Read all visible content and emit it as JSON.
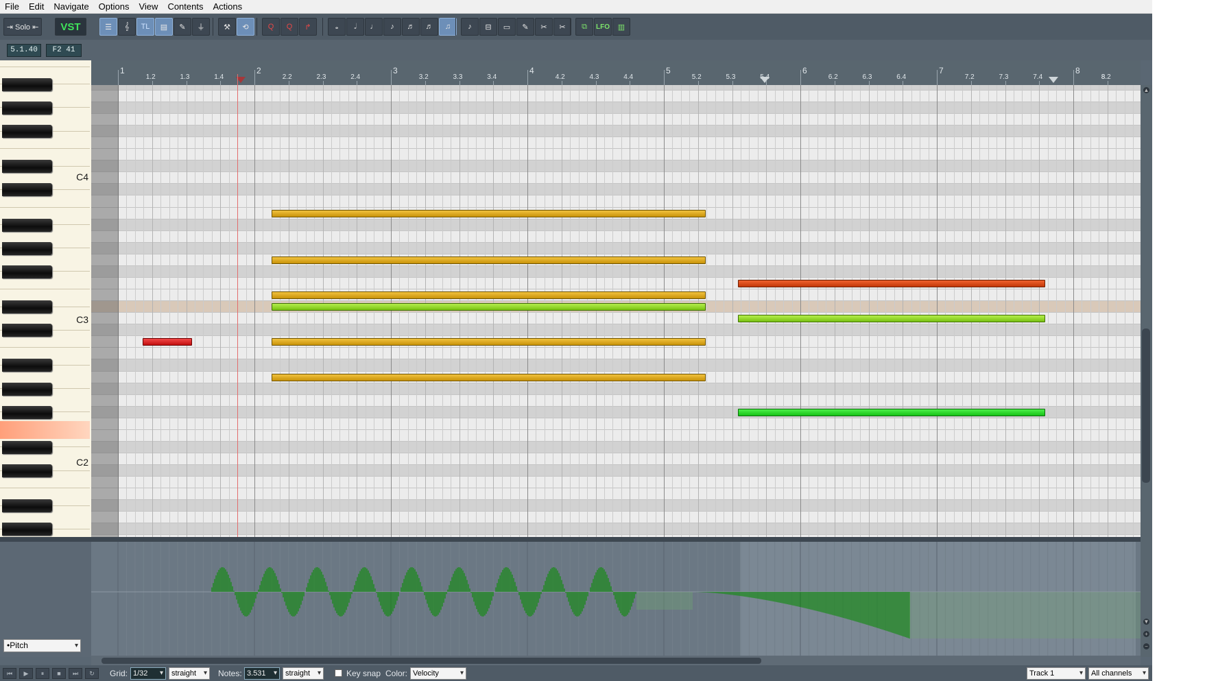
{
  "menu": [
    "File",
    "Edit",
    "Navigate",
    "Options",
    "View",
    "Contents",
    "Actions"
  ],
  "toolbar": {
    "solo_label": "⇥ Solo ⇤",
    "vst_label": "VST",
    "tl_label": "TL",
    "lfo_label": "LFO",
    "buttons": [
      "piano-roll-view-icon",
      "notation-view-icon",
      "timeline-toggle",
      "event-list-icon",
      "step-input-icon",
      "insert-icon",
      "humanize-icon",
      "loop-icon",
      "quantize-icon",
      "quantize-settings-icon",
      "redo-icon",
      "whole-note-icon",
      "half-note-icon",
      "quarter-note-icon",
      "eighth-note-icon",
      "sixteenth-note-icon",
      "thirtysecond-note-icon",
      "grid-note-icon",
      "legato-icon",
      "glue-icon",
      "velocity-icon",
      "draw-tool-icon",
      "erase-icon",
      "split-icon",
      "lane-view-icon",
      "lfo-icon",
      "mixer-icon"
    ]
  },
  "status": {
    "position": "5.1.40",
    "note": "F2 41"
  },
  "ruler": {
    "bars": [
      "1",
      "2",
      "3",
      "4",
      "5",
      "6",
      "7",
      "8"
    ],
    "beats": [
      "1.2",
      "1.3",
      "1.4",
      "2.2",
      "2.3",
      "2.4",
      "3.2",
      "3.3",
      "3.4",
      "4.2",
      "4.3",
      "4.4",
      "5.2",
      "5.3",
      "5.4",
      "6.2",
      "6.3",
      "6.4",
      "7.2",
      "7.3",
      "7.4",
      "8.2",
      "8."
    ]
  },
  "keyboard": {
    "labels": [
      "C4",
      "C3",
      "C2"
    ]
  },
  "notes": [
    {
      "name": "note",
      "pitch": "B3",
      "start": "2.1",
      "end": "5.2",
      "color": "gold",
      "hex": "#d9a51c"
    },
    {
      "name": "note",
      "pitch": "G3",
      "start": "2.1",
      "end": "5.2",
      "color": "gold",
      "hex": "#d9a51c"
    },
    {
      "name": "note",
      "pitch": "E3",
      "start": "2.1",
      "end": "5.2",
      "color": "gold",
      "hex": "#d9a51c"
    },
    {
      "name": "note",
      "pitch": "D#3",
      "start": "2.1",
      "end": "5.2",
      "color": "green",
      "hex": "#92d622"
    },
    {
      "name": "note",
      "pitch": "C3",
      "start": "2.1",
      "end": "5.2",
      "color": "gold",
      "hex": "#d9a51c"
    },
    {
      "name": "note",
      "pitch": "A2",
      "start": "2.1",
      "end": "5.2",
      "color": "gold",
      "hex": "#d9a51c"
    },
    {
      "name": "note",
      "pitch": "C3",
      "start": "1.2",
      "end": "1.3",
      "color": "red",
      "hex": "#d81e1e"
    },
    {
      "name": "note",
      "pitch": "F3",
      "start": "5.3",
      "end": "7.4",
      "color": "orange",
      "hex": "#d84a16"
    },
    {
      "name": "note",
      "pitch": "D3",
      "start": "5.3",
      "end": "7.4",
      "color": "green",
      "hex": "#92d622"
    },
    {
      "name": "note",
      "pitch": "F#2",
      "start": "5.3",
      "end": "7.4",
      "color": "bright-green",
      "hex": "#2fd82f"
    }
  ],
  "cc_lane": {
    "type": "•Pitch"
  },
  "bottom": {
    "grid_label": "Grid:",
    "grid_value": "1/32",
    "grid_mode": "straight",
    "notes_label": "Notes:",
    "notes_value": "3.531",
    "notes_mode": "straight",
    "key_snap": "Key snap",
    "color_label": "Color:",
    "color_value": "Velocity",
    "track": "Track 1",
    "channels": "All channels"
  },
  "colors": {
    "accent": "#6d8fb8",
    "background": "#5a6773",
    "grid": "#dcdcdc",
    "playhead": "#e36d6d"
  }
}
